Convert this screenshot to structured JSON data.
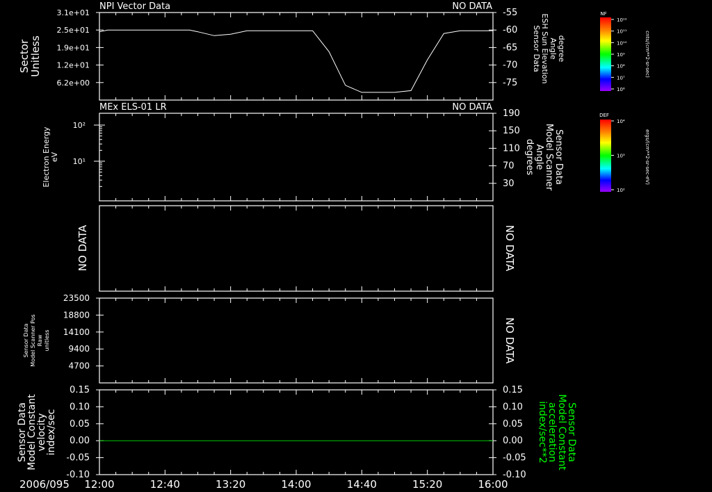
{
  "chart_data": [
    {
      "type": "line",
      "title": "NPI Vector Data",
      "status": "NO DATA",
      "ylabel_left": [
        "Sector",
        "Unitless"
      ],
      "yticks_left": [
        "3.1e+01",
        "2.5e+01",
        "1.9e+01",
        "1.2e+01",
        "6.2e+00"
      ],
      "ylabel_right": [
        "Sensor Data",
        "ESH Sun Elevation",
        "Angle",
        "degree"
      ],
      "yticks_right": [
        "-55",
        "-60",
        "-65",
        "-70",
        "-75"
      ],
      "ylim_right": [
        -80,
        -55
      ],
      "series": [
        {
          "x": [
            "12:00",
            "12:05",
            "12:20",
            "12:40",
            "12:55",
            "13:00",
            "13:10",
            "13:20",
            "13:30",
            "13:40",
            "14:00",
            "14:10",
            "14:20",
            "14:30",
            "14:40",
            "14:50",
            "15:00",
            "15:10",
            "15:20",
            "15:30",
            "15:40",
            "16:00"
          ],
          "y": [
            -60.5,
            -60,
            -60,
            -60,
            -60,
            -60.5,
            -61.6,
            -61.2,
            -60.2,
            -60.2,
            -60.2,
            -60.2,
            -66.2,
            -75.8,
            -77.8,
            -77.8,
            -77.8,
            -77.3,
            -68.5,
            -61,
            -60.2,
            -60.2
          ]
        }
      ],
      "colorbar": {
        "label": "NF",
        "unit": "cnts/(cm**2-sr-sec)",
        "ticks": [
          "10¹²",
          "10¹¹",
          "10¹⁰",
          "10⁹",
          "10⁸",
          "10⁷",
          "10⁶"
        ]
      }
    },
    {
      "type": "heatmap",
      "title": "MEx ELS-01 LR",
      "status": "NO DATA",
      "ylabel_left": [
        "Electron Energy",
        "eV"
      ],
      "yticks_left": [
        "10²",
        "10¹"
      ],
      "ylabel_right": [
        "Sensor Data",
        "Model Scanner",
        "Angle",
        "degrees"
      ],
      "yticks_right": [
        "190",
        "150",
        "110",
        "70",
        "30"
      ],
      "colorbar": {
        "label": "DEF",
        "unit": "ergs/(cm**2-sr-sec-eV)",
        "ticks": [
          "10⁴",
          "10³",
          "10²"
        ]
      }
    },
    {
      "type": "line",
      "ylabel_left": [
        "NO DATA"
      ],
      "status_right": "NO DATA"
    },
    {
      "type": "line",
      "ylabel_left": [
        "Sensor Data",
        "Model Scanner Pos",
        "Raw",
        "unitless"
      ],
      "yticks_left": [
        "23500",
        "18800",
        "14100",
        "9400",
        "4700"
      ],
      "status_right": "NO DATA"
    },
    {
      "type": "line",
      "ylabel_left": [
        "Sensor Data",
        "Model Constant",
        "velocity",
        "index/sec"
      ],
      "yticks_left": [
        "0.15",
        "0.10",
        "0.05",
        "0.00",
        "-0.05",
        "-0.10"
      ],
      "ylabel_right": [
        "Sensor Data",
        "Model Constant",
        "acceleration",
        "index/sec**2"
      ],
      "yticks_right": [
        "0.15",
        "0.10",
        "0.05",
        "0.00",
        "-0.05",
        "-0.10"
      ],
      "ylim": [
        -0.1,
        0.15
      ],
      "series": [
        {
          "x": [
            "12:00",
            "16:00"
          ],
          "y": [
            0.0,
            0.0
          ]
        }
      ],
      "colors": {
        "series": "#00cc00",
        "right_label": "#00ff00"
      }
    }
  ],
  "x_axis": {
    "date": "2006/095",
    "ticks": [
      "12:00",
      "12:40",
      "13:20",
      "14:00",
      "14:40",
      "15:20",
      "16:00"
    ],
    "xlim": [
      "12:00",
      "16:00"
    ]
  }
}
